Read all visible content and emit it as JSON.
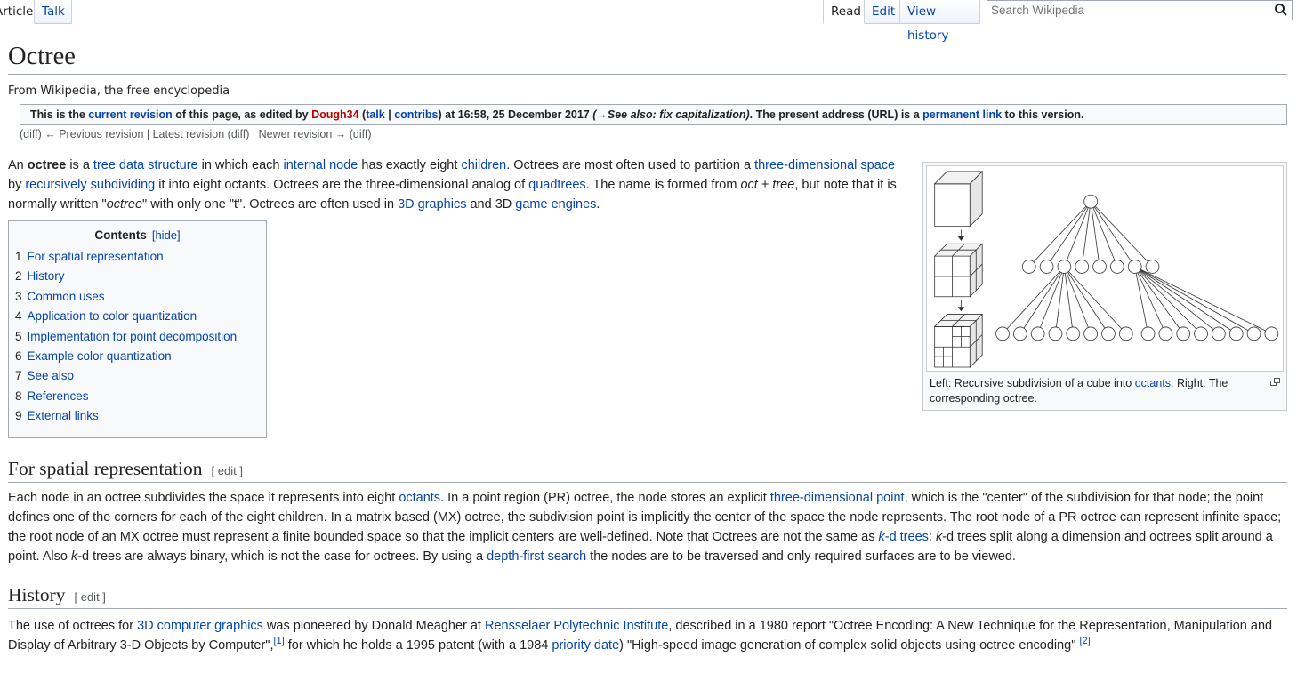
{
  "tabs": {
    "article": "Article",
    "talk": "Talk",
    "read": "Read",
    "edit": "Edit",
    "view_history": "View history"
  },
  "search": {
    "placeholder": "Search Wikipedia"
  },
  "title": "Octree",
  "tagline": "From Wikipedia, the free encyclopedia",
  "revision": {
    "p1": "This is the ",
    "current_revision": "current revision",
    "p2": " of this page, as edited by ",
    "user": "Dough34",
    "p3": " (",
    "talk": "talk",
    "sep": " | ",
    "contribs": "contribs",
    "p4": ") at 16:58, 25 December 2017 ",
    "summary": "(→See also: fix capitalization)",
    "p5": ". The present address (URL) is a ",
    "permanent_link": "permanent link",
    "p6": " to this version."
  },
  "revnav": "(diff) ← Previous revision | Latest revision (diff) | Newer revision → (diff)",
  "intro": {
    "t1": "An ",
    "bold": "octree",
    "t2": " is a ",
    "l_tree": "tree data structure",
    "t3": " in which each ",
    "l_internal": "internal node",
    "t4": " has exactly eight ",
    "l_children": "children",
    "t5": ". Octrees are most often used to partition a ",
    "l_3dspace": "three-dimensional space",
    "t6": " by ",
    "l_recursive": "recursively subdividing",
    "t7": " it into eight octants. Octrees are the three-dimensional analog of ",
    "l_quadtrees": "quadtrees",
    "t8": ". The name is formed from ",
    "i_oct": "oct",
    "t9": " + ",
    "i_tree": "tree",
    "t10": ", but note that it is normally written \"",
    "i_octree": "octree",
    "t11": "\" with only one \"t\". Octrees are often used in ",
    "l_3dgraphics": "3D graphics",
    "t12": " and 3D ",
    "l_engines": "game engines",
    "t13": "."
  },
  "toc": {
    "title": "Contents",
    "hide": "[hide]",
    "items": [
      {
        "num": "1",
        "label": "For spatial representation"
      },
      {
        "num": "2",
        "label": "History"
      },
      {
        "num": "3",
        "label": "Common uses"
      },
      {
        "num": "4",
        "label": "Application to color quantization"
      },
      {
        "num": "5",
        "label": "Implementation for point decomposition"
      },
      {
        "num": "6",
        "label": "Example color quantization"
      },
      {
        "num": "7",
        "label": "See also"
      },
      {
        "num": "8",
        "label": "References"
      },
      {
        "num": "9",
        "label": "External links"
      }
    ]
  },
  "figure": {
    "cap1": "Left: Recursive subdivision of a cube into ",
    "cap_link": "octants",
    "cap2": ". Right: The corresponding octree."
  },
  "sections": {
    "spatial": {
      "heading": "For spatial representation",
      "edit": "[ edit ]",
      "t1": "Each node in an octree subdivides the space it represents into eight ",
      "l_octants": "octants",
      "t2": ". In a point region (PR) octree, the node stores an explicit ",
      "l_point": "three-dimensional point",
      "t3": ", which is the \"center\" of the subdivision for that node; the point defines one of the corners for each of the eight children. In a matrix based (MX) octree, the subdivision point is implicitly the center of the space the node represents. The root node of a PR octree can represent infinite space; the root node of an MX octree must represent a finite bounded space so that the implicit centers are well-defined. Note that Octrees are not the same as ",
      "l_k": "k",
      "l_kd": "-d trees",
      "t4": ": ",
      "i_k1": "k",
      "t5": "-d trees split along a dimension and octrees split around a point. Also ",
      "i_k2": "k",
      "t6": "-d trees are always binary, which is not the case for octrees. By using a ",
      "l_dfs": "depth-first search",
      "t7": " the nodes are to be traversed and only required surfaces are to be viewed."
    },
    "history": {
      "heading": "History",
      "edit": "[ edit ]",
      "t1": "The use of octrees for ",
      "l_cg": "3D computer graphics",
      "t2": " was pioneered by Donald Meagher at ",
      "l_rpi": "Rensselaer Polytechnic Institute",
      "t3": ", described in a 1980 report \"Octree Encoding: A New Technique for the Representation, Manipulation and Display of Arbitrary 3-D Objects by Computer\",",
      "ref1": "[1]",
      "t4": " for which he holds a 1995 patent (with a 1984 ",
      "l_priority": "priority date",
      "t5": ") \"High-speed image generation of complex solid objects using octree encoding\" ",
      "ref2": "[2]"
    }
  }
}
